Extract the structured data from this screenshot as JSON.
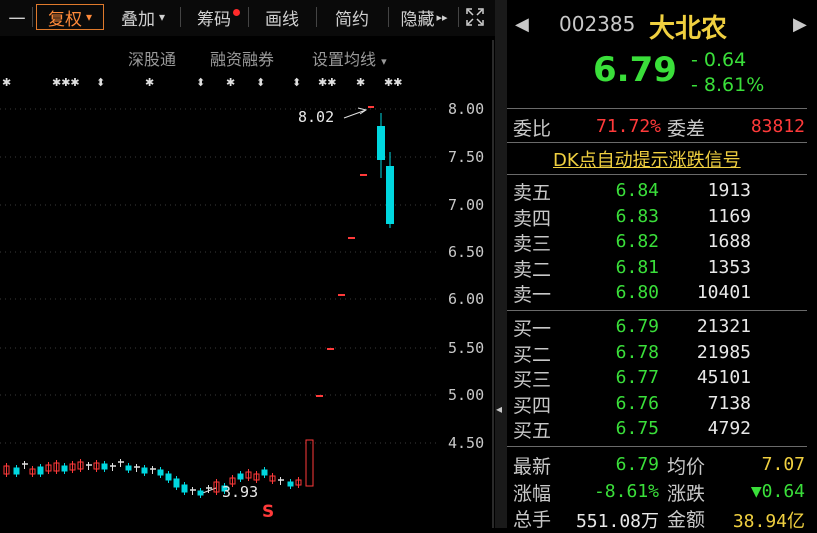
{
  "toolbar": {
    "first_label": "一",
    "buttons": [
      "复权",
      "叠加",
      "筹码",
      "画线",
      "简约",
      "隐藏"
    ],
    "fuquan_arrow": "▾",
    "diejia_arrow": "▾",
    "hide_arrows": "▸▸"
  },
  "sublinks": {
    "shen_gu_tong": "深股通",
    "rong_zi": "融资融券",
    "ma_settings": "设置均线",
    "ma_arrow": "▾"
  },
  "chart": {
    "y_labels": [
      "8.00",
      "7.50",
      "7.00",
      "6.50",
      "6.00",
      "5.50",
      "5.00",
      "4.50"
    ],
    "max_label": "8.02",
    "min_label": "3.93",
    "s_marker": "S",
    "colors": {
      "up": "#ff3a3a",
      "down": "#00d8e0",
      "flat": "#e0e0e0"
    }
  },
  "stock": {
    "code": "002385",
    "name": "大北农",
    "price": "6.79",
    "change": "- 0.64",
    "change_pct": "- 8.61%"
  },
  "ratios": {
    "weibi_label": "委比",
    "weibi_value": "71.72%",
    "weicha_label": "委差",
    "weicha_value": "83812"
  },
  "dk_signal": "DK点自动提示涨跌信号",
  "sell": [
    {
      "label": "卖五",
      "price": "6.84",
      "vol": "1913"
    },
    {
      "label": "卖四",
      "price": "6.83",
      "vol": "1169"
    },
    {
      "label": "卖三",
      "price": "6.82",
      "vol": "1688"
    },
    {
      "label": "卖二",
      "price": "6.81",
      "vol": "1353"
    },
    {
      "label": "卖一",
      "price": "6.80",
      "vol": "10401"
    }
  ],
  "buy": [
    {
      "label": "买一",
      "price": "6.79",
      "vol": "21321"
    },
    {
      "label": "买二",
      "price": "6.78",
      "vol": "21985"
    },
    {
      "label": "买三",
      "price": "6.77",
      "vol": "45101"
    },
    {
      "label": "买四",
      "price": "6.76",
      "vol": "7138"
    },
    {
      "label": "买五",
      "price": "6.75",
      "vol": "4792"
    }
  ],
  "stats": {
    "latest_label": "最新",
    "latest_value": "6.79",
    "avg_label": "均价",
    "avg_value": "7.07",
    "change_pct_label": "涨幅",
    "change_pct_value": "-8.61%",
    "change_label": "涨跌",
    "change_value": "▼0.64",
    "volume_label": "总手",
    "volume_value": "551.08万",
    "amount_label": "金额",
    "amount_value": "38.94亿"
  },
  "nav": {
    "prev": "◀",
    "next": "▶",
    "collapse": "◂"
  }
}
